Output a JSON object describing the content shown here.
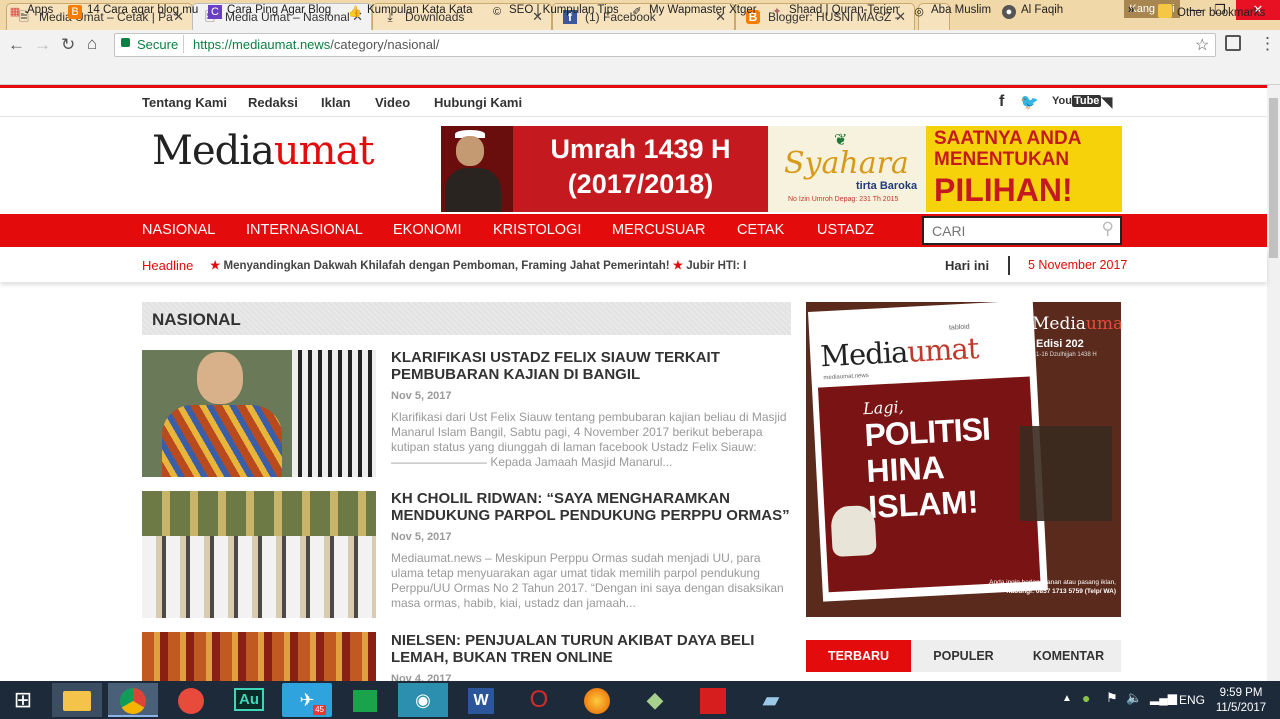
{
  "browser": {
    "tabs": [
      {
        "label": "Media Umat – Cetak | Pa",
        "icon": "page-icon"
      },
      {
        "label": "Media Umat – Nasional",
        "icon": "page-icon"
      },
      {
        "label": "Downloads",
        "icon": "download-icon"
      },
      {
        "label": "(1) Facebook",
        "icon": "facebook-icon"
      },
      {
        "label": "Blogger: HUSNI MAGZ -",
        "icon": "blogger-icon"
      }
    ],
    "user": "Kang Uni",
    "secure_label": "Secure",
    "url_host": "https://mediaumat.news",
    "url_path": "/category/nasional/",
    "bookmarks": [
      "Apps",
      "14 Cara agar blog mu",
      "Cara Ping Agar Blog",
      "Kumpulan Kata Kata",
      "SEO | Kumpulan Tips",
      "My Wapmaster Xtger",
      "Shaad | Quran-Terjem",
      "Aba Muslim",
      "Al Faqih"
    ],
    "more_bookmarks": "»",
    "other_bookmarks": "Other bookmarks"
  },
  "site": {
    "top_links": [
      "Tentang Kami",
      "Redaksi",
      "Iklan",
      "Video",
      "Hubungi Kami"
    ],
    "logo_part1": "Media",
    "logo_part2": "umat",
    "banner": {
      "umrah_line1": "Umrah 1439 H",
      "umrah_line2": "(2017/2018)",
      "brand": "Syahara",
      "brand_sub": "tirta Baroka",
      "license": "No Izin Umroh Depag: 231 Th 2015",
      "slogan_line1": "SAATNYA ANDA",
      "slogan_line2": "MENENTUKAN",
      "slogan_line3": "PILIHAN!"
    },
    "nav": [
      "NASIONAL",
      "INTERNASIONAL",
      "EKONOMI",
      "KRISTOLOGI",
      "MERCUSUAR",
      "CETAK",
      "USTADZ"
    ],
    "search_placeholder": "CARI",
    "headline_label": "Headline",
    "ticker_1": "Menyandingkan Dakwah Khilafah dengan Pemboman, Framing Jahat Pemerintah!",
    "ticker_2": "Jubir HTI: I",
    "today_label": "Hari ini",
    "today_date": "5 November 2017",
    "section_title": "NASIONAL",
    "articles": [
      {
        "title": "KLARIFIKASI USTADZ FELIX SIAUW TERKAIT PEMBUBARAN KAJIAN DI BANGIL",
        "date": "Nov 5, 2017",
        "excerpt": "Klarifikasi dari Ust Felix Siauw tentang pembubaran kajian beliau di Masjid Manarul Islam Bangil, Sabtu pagi, 4 November 2017 berikut beberapa kutipan status yang diunggah di laman facebook Ustadz Felix Siauw: ———————— Kepada Jamaah Masjid Manarul..."
      },
      {
        "title": "KH CHOLIL RIDWAN: “SAYA MENGHARAMKAN MENDUKUNG PARPOL PENDUKUNG PERPPU ORMAS”",
        "date": "Nov 5, 2017",
        "excerpt": "Mediaumat.news – Meskipun Perppu Ormas sudah menjadi UU, para ulama tetap menyuarakan agar umat tidak memilih parpol pendukung Perppu/UU Ormas No 2 Tahun 2017. “Dengan ini saya dengan disaksikan masa ormas, habib, kiai, ustadz dan jamaah..."
      },
      {
        "title": "NIELSEN: PENJUALAN TURUN AKIBAT DAYA BELI LEMAH, BUKAN TREN ONLINE",
        "date": "Nov 4, 2017",
        "excerpt": ""
      }
    ],
    "magazine": {
      "tabloid": "tabloid",
      "name_part1": "Media",
      "name_part2": "umat",
      "site": "mediaumat.news",
      "edition": "Edisi 202",
      "edition_dates": "1-16 Dzulhijjah 1438 H",
      "headline_1": "Lagi,",
      "headline_2": "POLITISI",
      "headline_3": "HINA",
      "headline_4": "ISLAM!",
      "contact_1": "Anda ingin berlangganan atau pasang iklan,",
      "contact_2": "hubungi: 0857 1713 5759 (Telp/ WA)"
    },
    "sidebar_tabs": [
      "TERBARU",
      "POPULER",
      "KOMENTAR"
    ]
  },
  "taskbar": {
    "lang": "ENG",
    "time": "9:59 PM",
    "date": "11/5/2017",
    "telegram_badge": "45"
  },
  "colors": {
    "brand_red": "#e30b0b",
    "tab_bg": "#f0d8a8"
  }
}
